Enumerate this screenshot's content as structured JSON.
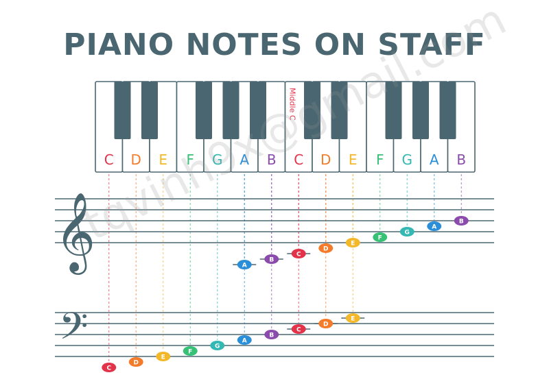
{
  "title": "PIANO NOTES ON STAFF",
  "keyboard": {
    "white_keys": [
      "C",
      "D",
      "E",
      "F",
      "G",
      "A",
      "B",
      "C",
      "D",
      "E",
      "F",
      "G",
      "A",
      "B"
    ],
    "middle_c_label": "Middle C",
    "middle_c_index": 7
  },
  "note_colors": {
    "C": "#e2334a",
    "D": "#f47b2a",
    "E": "#f2b82a",
    "F": "#36c175",
    "G": "#33b8b3",
    "A": "#2a8fd8",
    "B": "#8a4bad"
  },
  "treble_notes": [
    {
      "name": "A",
      "key": 5,
      "pos": -2,
      "ledger": true
    },
    {
      "name": "B",
      "key": 6,
      "pos": -1,
      "ledger": true
    },
    {
      "name": "C",
      "key": 7,
      "pos": 0,
      "ledger": true
    },
    {
      "name": "D",
      "key": 8,
      "pos": 1,
      "ledger": false
    },
    {
      "name": "E",
      "key": 9,
      "pos": 2,
      "ledger": false
    },
    {
      "name": "F",
      "key": 10,
      "pos": 3,
      "ledger": false
    },
    {
      "name": "G",
      "key": 11,
      "pos": 4,
      "ledger": false
    },
    {
      "name": "A",
      "key": 12,
      "pos": 5,
      "ledger": false
    },
    {
      "name": "B",
      "key": 13,
      "pos": 6,
      "ledger": false
    }
  ],
  "bass_notes": [
    {
      "name": "C",
      "key": 0,
      "pos": 1,
      "ledger": false
    },
    {
      "name": "D",
      "key": 1,
      "pos": 2,
      "ledger": false
    },
    {
      "name": "E",
      "key": 2,
      "pos": 3,
      "ledger": false
    },
    {
      "name": "F",
      "key": 3,
      "pos": 4,
      "ledger": false
    },
    {
      "name": "G",
      "key": 4,
      "pos": 5,
      "ledger": false
    },
    {
      "name": "A",
      "key": 5,
      "pos": 6,
      "ledger": false
    },
    {
      "name": "B",
      "key": 6,
      "pos": 7,
      "ledger": false
    },
    {
      "name": "C",
      "key": 7,
      "pos": 8,
      "ledger": true
    },
    {
      "name": "D",
      "key": 8,
      "pos": 9,
      "ledger": true
    },
    {
      "name": "E",
      "key": 9,
      "pos": 10,
      "ledger": true
    }
  ],
  "clefs": {
    "treble_glyph": "𝄞",
    "bass_glyph": "𝄢"
  },
  "watermark": "tqvinh9x@gmail.com"
}
